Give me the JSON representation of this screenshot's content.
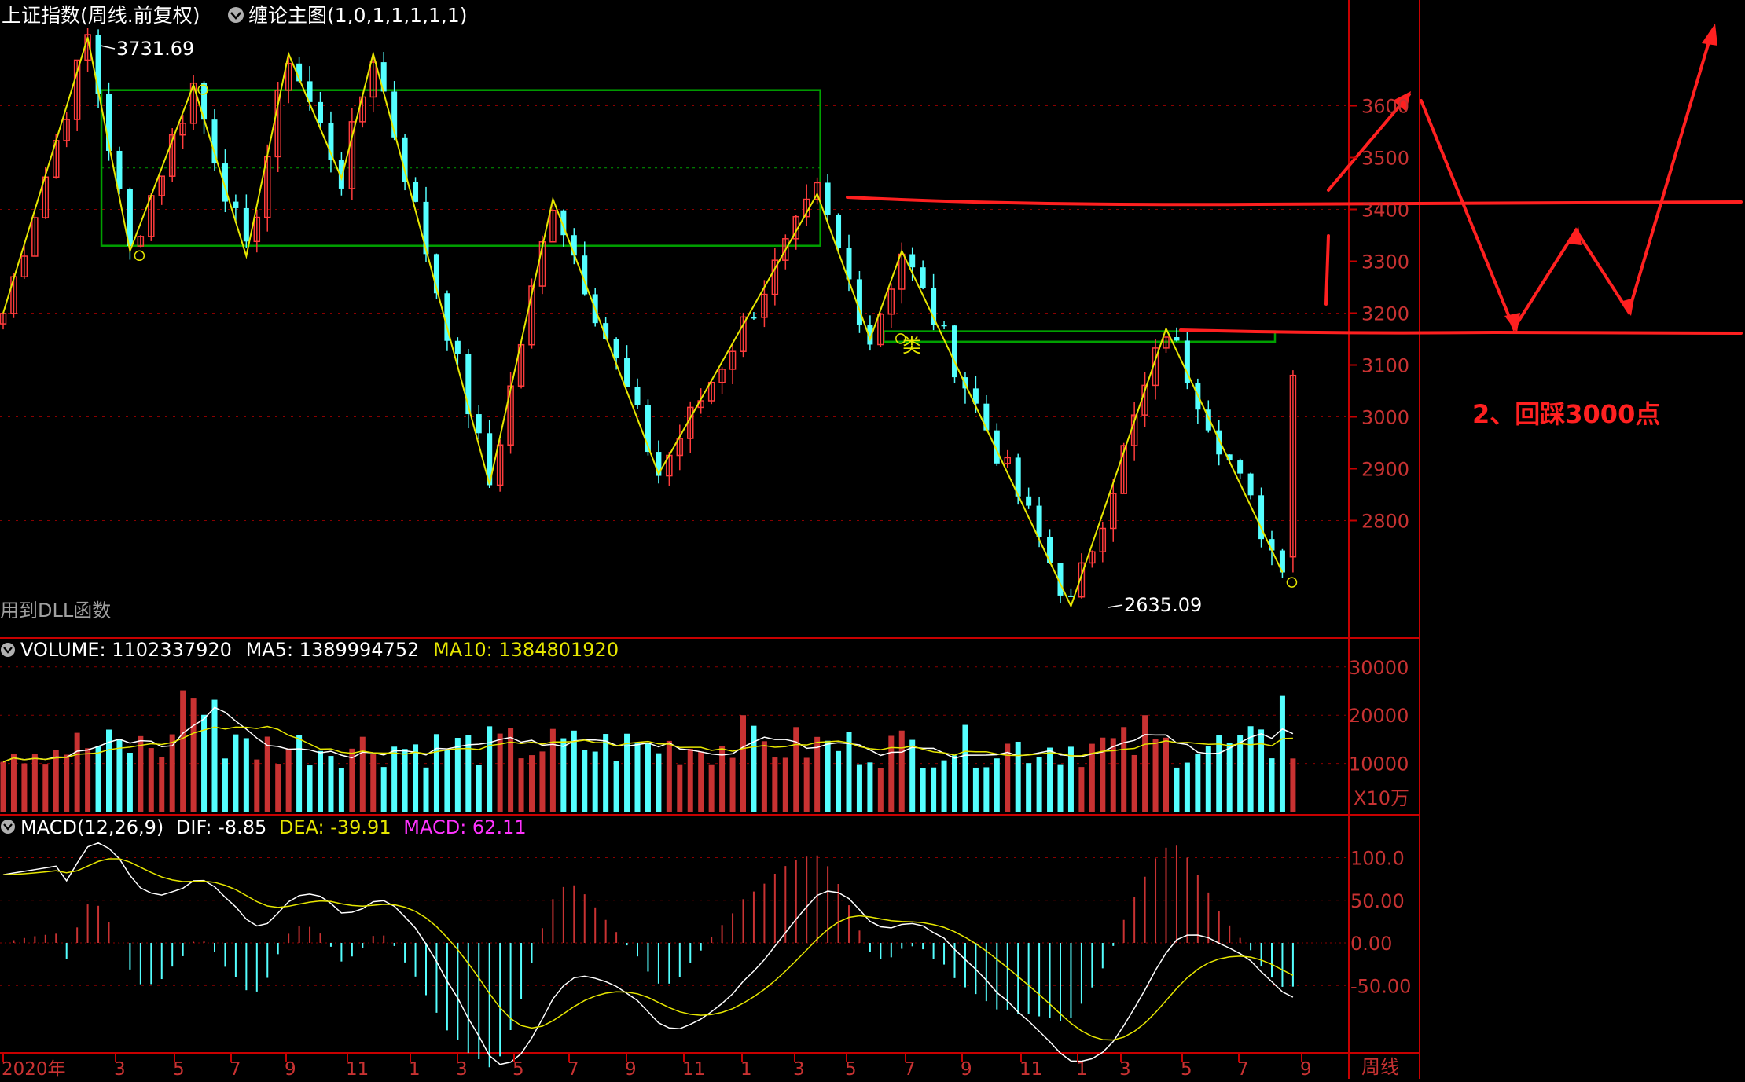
{
  "header": {
    "main_title": "上证指数(周线.前复权)",
    "indicator_title": "缠论主图(1,0,1,1,1,1,1)",
    "dll_note": "用到DLL函数"
  },
  "volume_header": {
    "label": "VOLUME: 1102337920",
    "ma5": "MA5: 1389994752",
    "ma10": "MA10: 1384801920"
  },
  "macd_header": {
    "label": "MACD(12,26,9)",
    "dif": "DIF: -8.85",
    "dea": "DEA: -39.91",
    "macd": "MACD: 62.11"
  },
  "right_axis": {
    "price_ticks": [
      "3600",
      "3500",
      "3400",
      "3300",
      "3200",
      "3100",
      "3000",
      "2900",
      "2800"
    ],
    "volume_ticks": [
      "30000",
      "20000",
      "10000"
    ],
    "volume_unit": "X10万",
    "macd_ticks": [
      "100.0",
      "50.00",
      "0.00",
      "-50.00"
    ],
    "period_label": "周线"
  },
  "annotation": {
    "text": "2、回踩3000点"
  },
  "markers": {
    "lei_label": "类"
  },
  "colors": {
    "up": "#ff3c3c",
    "down": "#54ffff",
    "zigzag": "#e6e600",
    "center_box": "#00a000",
    "grid": "#8a0000",
    "axis": "#c80000",
    "annotation": "#ff2020",
    "ma5": "#ffffff",
    "ma10": "#e6e600",
    "dea": "#e6e600",
    "macd_label": "#ff33ff"
  },
  "chart_data": [
    {
      "type": "candlestick",
      "title": "上证指数(周线.前复权)",
      "xlabel": "",
      "ylabel": "",
      "x_ticks": [
        "2020年",
        "3",
        "5",
        "7",
        "9",
        "11",
        "1",
        "3",
        "5",
        "7",
        "9",
        "11",
        "1",
        "3",
        "5",
        "7",
        "9",
        "11",
        "1",
        "3",
        "5",
        "7",
        "9"
      ],
      "ylim": [
        2600,
        3800
      ],
      "annotations": [
        "3731.69",
        "2635.09"
      ],
      "zigzag": [
        {
          "bar": 0,
          "price": 3200
        },
        {
          "bar": 8,
          "price": 3731.69
        },
        {
          "bar": 12,
          "price": 3320
        },
        {
          "bar": 18,
          "price": 3640
        },
        {
          "bar": 23,
          "price": 3310
        },
        {
          "bar": 27,
          "price": 3700
        },
        {
          "bar": 32,
          "price": 3460
        },
        {
          "bar": 35,
          "price": 3700
        },
        {
          "bar": 46,
          "price": 2870
        },
        {
          "bar": 52,
          "price": 3420
        },
        {
          "bar": 62,
          "price": 2890
        },
        {
          "bar": 77,
          "price": 3430
        },
        {
          "bar": 82,
          "price": 3150
        },
        {
          "bar": 85,
          "price": 3320
        },
        {
          "bar": 101,
          "price": 2635.09
        },
        {
          "bar": 110,
          "price": 3170
        },
        {
          "bar": 121,
          "price": 2700
        }
      ],
      "center_boxes": [
        {
          "from_bar": 9,
          "to_bar": 77,
          "low": 3330,
          "high": 3630
        },
        {
          "from_bar": 83,
          "to_bar": 120,
          "low": 3145,
          "high": 3165
        }
      ],
      "last_bar": {
        "open": 2730,
        "high": 3090,
        "low": 2700,
        "close": 3080
      }
    },
    {
      "type": "bar",
      "title": "VOLUME",
      "xlabel": "",
      "ylabel": "X10万",
      "ylim": [
        0,
        30000
      ],
      "series": [
        {
          "name": "VOLUME",
          "last": 1102337920
        },
        {
          "name": "MA5",
          "last": 1389994752
        },
        {
          "name": "MA10",
          "last": 1384801920
        }
      ]
    },
    {
      "type": "bar",
      "title": "MACD(12,26,9)",
      "xlabel": "",
      "ylabel": "",
      "ylim": [
        -100,
        100
      ],
      "series": [
        {
          "name": "DIF",
          "last": -8.85
        },
        {
          "name": "DEA",
          "last": -39.91
        },
        {
          "name": "MACD",
          "last": 62.11
        }
      ]
    }
  ]
}
